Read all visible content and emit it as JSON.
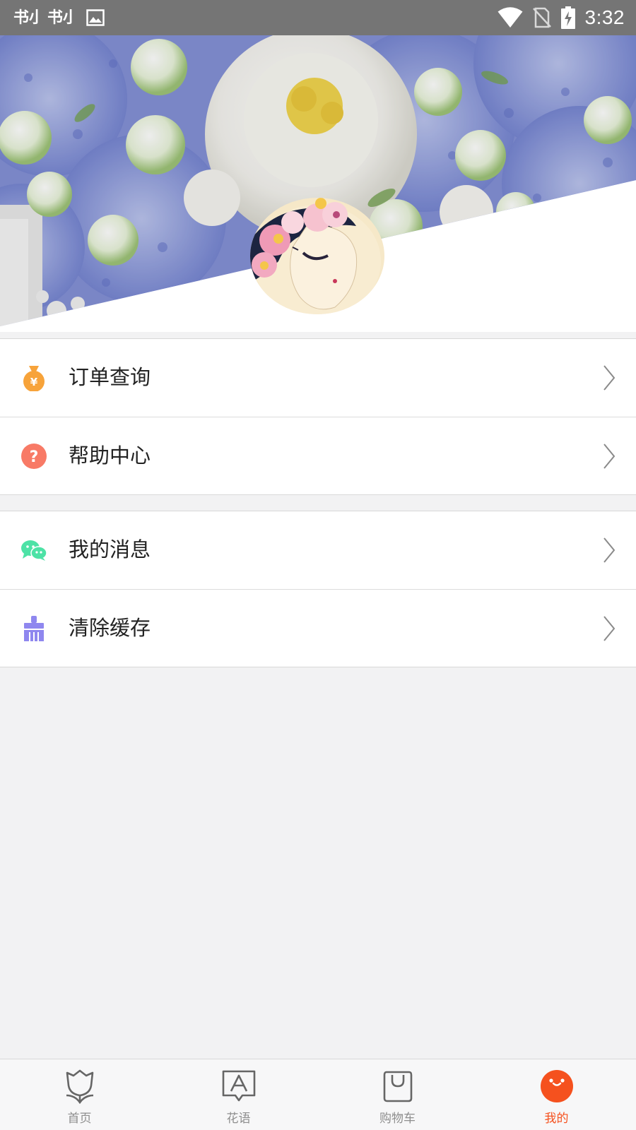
{
  "status_bar": {
    "time": "3:32",
    "notifications": [
      {
        "icon": "book-novel-app-icon",
        "text": "书小说"
      },
      {
        "icon": "book-novel-app-icon",
        "text": "书小说"
      },
      {
        "icon": "gallery-icon"
      }
    ],
    "system_icons": [
      "wifi-icon",
      "no-sim-icon",
      "battery-charging-icon"
    ]
  },
  "profile": {
    "header_image": "flowers-photo",
    "avatar": "avatar-illustration"
  },
  "menu": {
    "group1": [
      {
        "label": "订单查询",
        "icon": "money-bag-icon",
        "icon_color": "#f7a33a"
      },
      {
        "label": "帮助中心",
        "icon": "help-icon",
        "icon_color": "#f87a66"
      }
    ],
    "group2": [
      {
        "label": "我的消息",
        "icon": "chat-bubbles-icon",
        "icon_color": "#4de2a6"
      },
      {
        "label": "清除缓存",
        "icon": "brush-icon",
        "icon_color": "#8f87ef"
      }
    ]
  },
  "bottom_nav": {
    "items": [
      {
        "label": "首页",
        "icon": "tulip-icon",
        "active": false
      },
      {
        "label": "花语",
        "icon": "letter-a-icon",
        "active": false
      },
      {
        "label": "购物车",
        "icon": "shopping-bag-icon",
        "active": false
      },
      {
        "label": "我的",
        "icon": "smiley-face-icon",
        "active": true
      }
    ],
    "active_color": "#f5511e",
    "inactive_color": "#8e8e8e"
  }
}
